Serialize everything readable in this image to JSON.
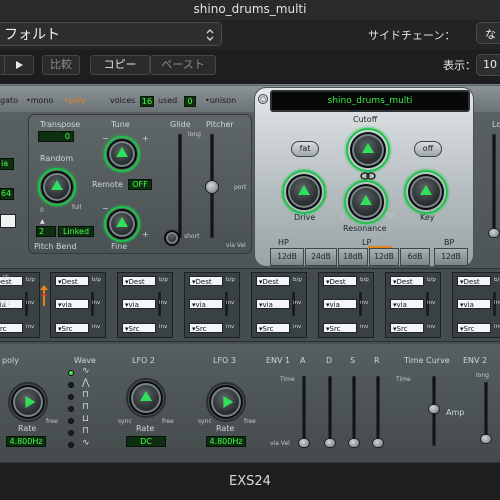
{
  "window": {
    "title": "shino_drums_multi"
  },
  "preset_bar": {
    "preset": "フォルト",
    "sidechain_label": "サイドチェーン：",
    "sidechain_value": "な"
  },
  "toolbar": {
    "compare": "比較",
    "copy": "コピー",
    "paste": "ペースト",
    "display_label": "表示：",
    "display_value": "10"
  },
  "top_strip": {
    "legato": "gato",
    "mono": "mono",
    "poly": "poly",
    "voices_label": "voices",
    "voices_value": "16",
    "used_label": "used",
    "used_value": "0",
    "unison": "unison"
  },
  "left_edge": {
    "lcd_a": "ia",
    "lcd_b": "64"
  },
  "pitch_section": {
    "transpose_label": "Transpose",
    "transpose_value": "0",
    "tune_label": "Tune",
    "random_label": "Random",
    "remote_label": "Remote",
    "remote_value": "OFF",
    "fine_label": "Fine",
    "pitch_bend_label": "Pitch  Bend",
    "bend_value": "2",
    "linked_value": "Linked",
    "full": "full",
    "glide_label": "Glide",
    "pitcher_label": "Pitcher",
    "long": "long",
    "short": "short",
    "port": "port",
    "via_vel": "via Vel",
    "minus": "−",
    "plus": "+",
    "zero": "0"
  },
  "filter": {
    "instrument_name": "shino_drums_multi",
    "cutoff_label": "Cutoff",
    "fat_label": "fat",
    "off_label": "off",
    "drive_label": "Drive",
    "resonance_label": "Resonance",
    "key_label": "Key",
    "open": "open",
    "full": "full",
    "zero": "0",
    "hp_label": "HP",
    "lp_label": "LP",
    "bp_label": "BP",
    "slopes": [
      "12dB",
      "24dB",
      "18dB",
      "12dB",
      "6dB",
      "12dB"
    ]
  },
  "right_edge": {
    "lo": "Lo"
  },
  "matrix": {
    "dest": "Dest",
    "via": "via",
    "src": "Src",
    "bp": "b/p",
    "inv": "inv",
    "first_extra_a": "ch",
    "first_extra_b": "#1",
    "slot_count": 8
  },
  "lower": {
    "poly_label": "poly",
    "wave_label": "Wave",
    "lfo2_label": "LFO 2",
    "lfo3_label": "LFO 3",
    "rate_label": "Rate",
    "rate_value_1": "4.800Hz",
    "rate_value_2": "DC",
    "rate_value_3": "4.800Hz",
    "sync": "sync",
    "free": "free",
    "env1_label": "ENV 1",
    "env2_label": "ENV 2",
    "adsr": [
      "A",
      "D",
      "S",
      "R"
    ],
    "time_label": "Time",
    "long": "long",
    "short": "short",
    "full": "full",
    "zero": "0",
    "via_vel": "via Vel",
    "time_curve_label": "Time Curve",
    "amp_label": "Amp"
  },
  "footer": {
    "name": "EXS24"
  },
  "colors": {
    "lcd_green": "#48ff4c",
    "accent_orange": "#e2861b",
    "knob_ring": "#1fc24b"
  }
}
